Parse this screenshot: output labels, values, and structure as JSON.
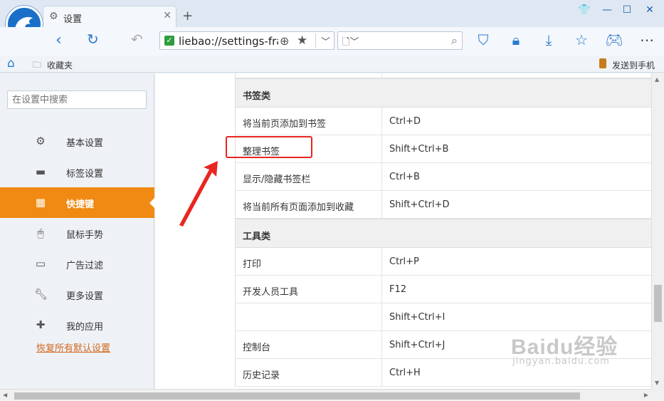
{
  "tab": {
    "title": "设置"
  },
  "address": {
    "url": "liebao://settings-fra"
  },
  "bookmarks_bar": {
    "favorites": "收藏夹",
    "send_to_phone": "发送到手机"
  },
  "sidebar": {
    "search_placeholder": "在设置中搜索",
    "items": [
      {
        "label": "基本设置",
        "icon": "gear-icon"
      },
      {
        "label": "标签设置",
        "icon": "tab-icon"
      },
      {
        "label": "快捷键",
        "icon": "shortcut-icon",
        "active": true
      },
      {
        "label": "鼠标手势",
        "icon": "mouse-icon"
      },
      {
        "label": "广告过滤",
        "icon": "window-icon"
      },
      {
        "label": "更多设置",
        "icon": "wrench-icon"
      },
      {
        "label": "我的应用",
        "icon": "puzzle-icon"
      }
    ],
    "restore": "恢复所有默认设置"
  },
  "shortcuts": {
    "bookmarks_section": "书签类",
    "bookmarks": [
      {
        "action": "将当前页添加到书签",
        "key": "Ctrl+D"
      },
      {
        "action": "整理书签",
        "key": "Shift+Ctrl+B"
      },
      {
        "action": "显示/隐藏书签栏",
        "key": "Ctrl+B"
      },
      {
        "action": "将当前所有页面添加到收藏",
        "key": "Shift+Ctrl+D"
      }
    ],
    "tools_section": "工具类",
    "tools": [
      {
        "action": "打印",
        "key": "Ctrl+P"
      },
      {
        "action": "开发人员工具",
        "key": "F12"
      },
      {
        "action": "",
        "key": "Shift+Ctrl+I"
      },
      {
        "action": "控制台",
        "key": "Shift+Ctrl+J"
      },
      {
        "action": "历史记录",
        "key": "Ctrl+H"
      }
    ]
  },
  "watermark": {
    "brand": "Baidu经验",
    "url": "jingyan.baidu.com"
  },
  "colors": {
    "accent": "#f08a12",
    "highlight": "#e8261f",
    "link": "#d2691e",
    "icon_blue": "#2b7bd0"
  }
}
